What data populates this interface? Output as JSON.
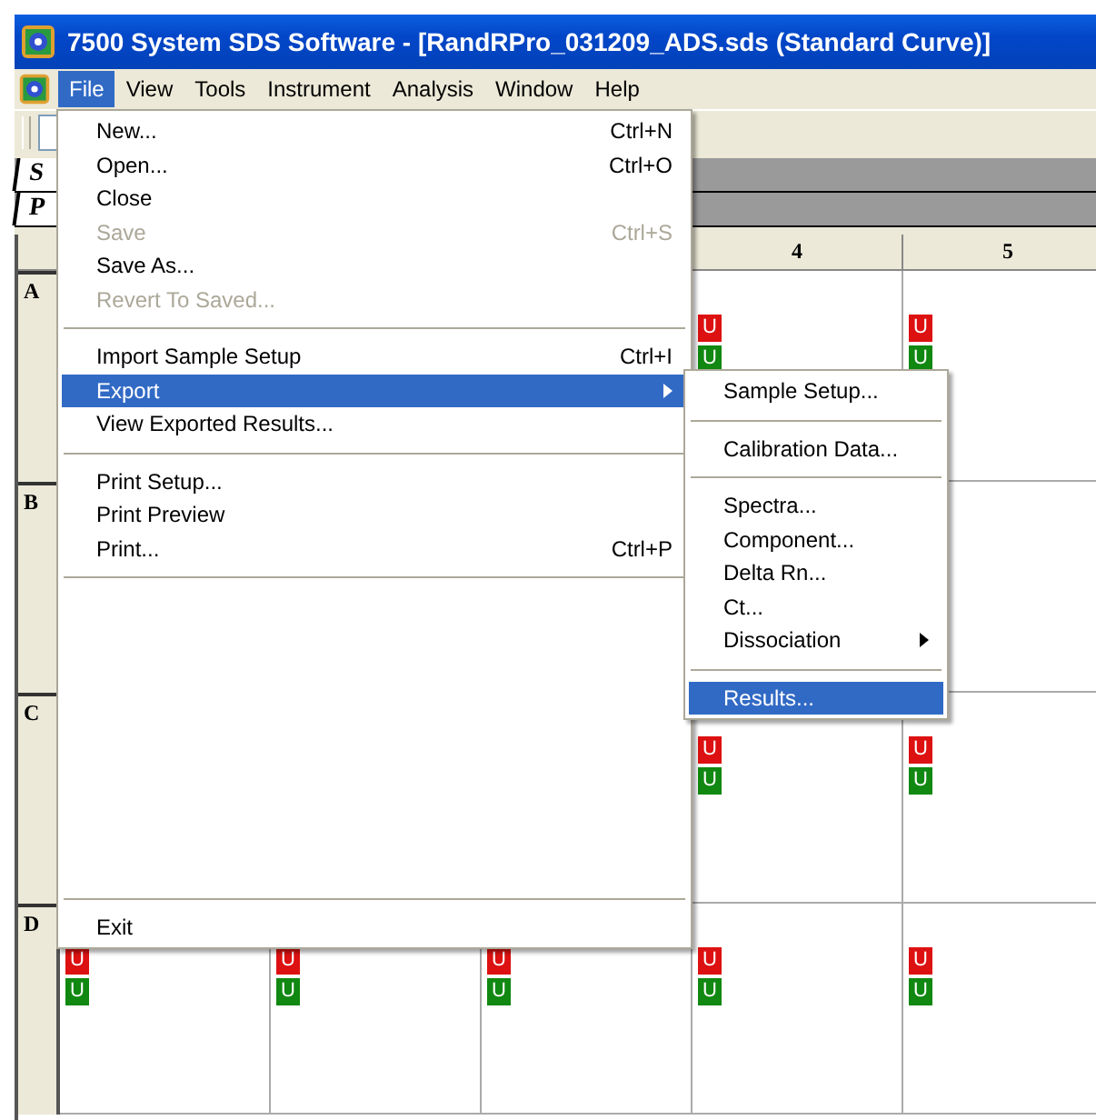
{
  "window": {
    "title": "7500 System SDS Software - [RandRPro_031209_ADS.sds (Standard Curve)]"
  },
  "menu_bar": [
    {
      "label": "File",
      "selected": true
    },
    {
      "label": "View",
      "selected": false
    },
    {
      "label": "Tools",
      "selected": false
    },
    {
      "label": "Instrument",
      "selected": false
    },
    {
      "label": "Analysis",
      "selected": false
    },
    {
      "label": "Window",
      "selected": false
    },
    {
      "label": "Help",
      "selected": false
    }
  ],
  "view_tabs": [
    {
      "label": "S"
    },
    {
      "label": "P"
    }
  ],
  "plate": {
    "columns": [
      {
        "label": "4"
      },
      {
        "label": "5"
      }
    ],
    "rows": [
      {
        "label": "A",
        "wells": [
          {
            "tags": [
              {
                "text": "U",
                "color": "#dd1111"
              },
              {
                "text": "U",
                "color": "#118811"
              }
            ]
          },
          {
            "tags": [
              {
                "text": "U",
                "color": "#dd1111"
              },
              {
                "text": "U",
                "color": "#118811"
              }
            ]
          }
        ]
      },
      {
        "label": "B"
      },
      {
        "label": "C",
        "wells": [
          {
            "tags": [
              {
                "text": "U",
                "color": "#dd1111"
              },
              {
                "text": "U",
                "color": "#118811"
              }
            ]
          },
          {
            "tags": [
              {
                "text": "U",
                "color": "#dd1111"
              },
              {
                "text": "U",
                "color": "#118811"
              }
            ]
          }
        ]
      },
      {
        "label": "D",
        "wells": [
          {
            "tags": [
              {
                "text": "U",
                "color": "#dd1111"
              },
              {
                "text": "U",
                "color": "#118811"
              }
            ]
          },
          {
            "tags": [
              {
                "text": "U",
                "color": "#dd1111"
              },
              {
                "text": "U",
                "color": "#118811"
              }
            ]
          },
          {
            "tags": [
              {
                "text": "U",
                "color": "#dd1111"
              },
              {
                "text": "U",
                "color": "#118811"
              }
            ]
          },
          {
            "tags": [
              {
                "text": "U",
                "color": "#dd1111"
              },
              {
                "text": "U",
                "color": "#118811"
              }
            ]
          },
          {
            "tags": [
              {
                "text": "U",
                "color": "#dd1111"
              },
              {
                "text": "U",
                "color": "#118811"
              }
            ]
          }
        ]
      }
    ]
  },
  "file_menu": {
    "items": [
      {
        "kind": "item",
        "label": "New...",
        "shortcut": "Ctrl+N",
        "disabled": false,
        "selected": false
      },
      {
        "kind": "item",
        "label": "Open...",
        "shortcut": "Ctrl+O",
        "disabled": false,
        "selected": false
      },
      {
        "kind": "item",
        "label": "Close",
        "disabled": false,
        "selected": false
      },
      {
        "kind": "item",
        "label": "Save",
        "shortcut": "Ctrl+S",
        "disabled": true,
        "selected": false
      },
      {
        "kind": "item",
        "label": "Save As...",
        "disabled": false,
        "selected": false
      },
      {
        "kind": "item",
        "label": "Revert To Saved...",
        "disabled": true,
        "selected": false
      },
      {
        "kind": "separator"
      },
      {
        "kind": "item",
        "label": "Import Sample Setup",
        "shortcut": "Ctrl+I",
        "disabled": false,
        "selected": false
      },
      {
        "kind": "submenu",
        "label": "Export",
        "disabled": false,
        "selected": true
      },
      {
        "kind": "item",
        "label": "View Exported Results...",
        "disabled": false,
        "selected": false
      },
      {
        "kind": "separator"
      },
      {
        "kind": "item",
        "label": "Print Setup...",
        "disabled": false,
        "selected": false
      },
      {
        "kind": "item",
        "label": "Print Preview",
        "disabled": false,
        "selected": false
      },
      {
        "kind": "item",
        "label": "Print...",
        "shortcut": "Ctrl+P",
        "disabled": false,
        "selected": false
      },
      {
        "kind": "separator"
      }
    ],
    "footer_items": [
      {
        "kind": "separator"
      },
      {
        "kind": "item",
        "label": "Exit",
        "disabled": false,
        "selected": false
      }
    ]
  },
  "export_submenu": {
    "items": [
      {
        "kind": "item",
        "label": "Sample Setup...",
        "selected": false
      },
      {
        "kind": "separator"
      },
      {
        "kind": "item",
        "label": "Calibration Data...",
        "selected": false
      },
      {
        "kind": "separator"
      },
      {
        "kind": "item",
        "label": "Spectra...",
        "selected": false
      },
      {
        "kind": "item",
        "label": "Component...",
        "selected": false
      },
      {
        "kind": "item",
        "label": "Delta Rn...",
        "selected": false
      },
      {
        "kind": "item",
        "label": "Ct...",
        "selected": false
      },
      {
        "kind": "submenu",
        "label": "Dissociation",
        "selected": false
      },
      {
        "kind": "separator"
      },
      {
        "kind": "item",
        "label": "Results...",
        "selected": true
      }
    ]
  }
}
